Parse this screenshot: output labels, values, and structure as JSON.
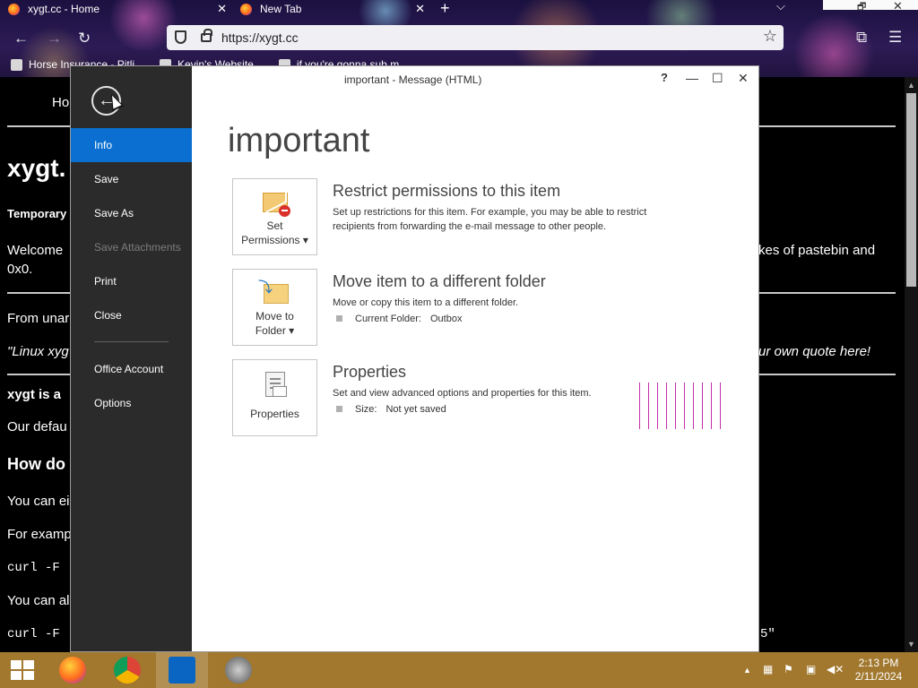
{
  "browser": {
    "tabs": [
      {
        "title": "xygt.cc - Home",
        "close": "✕"
      },
      {
        "title": "New Tab",
        "close": "✕"
      }
    ],
    "new_tab": "+",
    "window_controls": {
      "dropdown": "⌵",
      "restore": "🗗",
      "close": "✕"
    },
    "nav": {
      "back": "←",
      "forward": "→",
      "reload": "↻"
    },
    "url": "https://xygt.cc",
    "bookmark_star": "☆",
    "toolbar": {
      "extensions": "⧉",
      "menu": "☰"
    },
    "bookmarks": [
      {
        "label": "Horse Insurance - Pitli"
      },
      {
        "label": "Kevin's Website"
      },
      {
        "label": "if you're gonna sub m..."
      }
    ]
  },
  "webpage": {
    "nav_home": "Ho",
    "site_title": "xygt.",
    "subtitle": "Temporary",
    "welcome": "Welcome",
    "welcome_right": "kes of pastebin and",
    "line_0x0": "0x0.",
    "from_unar": "From unar",
    "quote_left": "\"Linux xyg",
    "quote_right": "ur own quote here!",
    "xygt_is_a": "xygt is a",
    "our_defau": "Our defau",
    "how_do": "How do",
    "you_can_ei": "You can ei",
    "for_examp": "For examp",
    "curl_1": "curl -F",
    "you_can_al": "You can al",
    "curl_2": "curl -F",
    "curl_2_end": "5\""
  },
  "outlook": {
    "window_title": "important - Message (HTML)",
    "title_controls": {
      "help": "?",
      "minimize": "—",
      "maximize": "☐",
      "close": "✕"
    },
    "back_label": "←",
    "sidebar": [
      {
        "label": "Info",
        "state": "active"
      },
      {
        "label": "Save",
        "state": "normal"
      },
      {
        "label": "Save As",
        "state": "normal"
      },
      {
        "label": "Save Attachments",
        "state": "disabled"
      },
      {
        "label": "Print",
        "state": "normal"
      },
      {
        "label": "Close",
        "state": "normal"
      },
      {
        "label": "Office Account",
        "state": "normal"
      },
      {
        "label": "Options",
        "state": "normal"
      }
    ],
    "heading": "important",
    "sections": [
      {
        "tile_label_1": "Set",
        "tile_label_2": "Permissions ▾",
        "icon": "envelope-restrict-icon",
        "title": "Restrict permissions to this item",
        "desc_1": "Set up restrictions for this item. For example, you may be able to restrict",
        "desc_2": "recipients from forwarding the e-mail message to other people."
      },
      {
        "tile_label_1": "Move to",
        "tile_label_2": "Folder ▾",
        "icon": "folder-move-icon",
        "title": "Move item to a different folder",
        "desc_1": "Move or copy this item to a different folder.",
        "kv_key": "Current Folder:",
        "kv_val": "Outbox"
      },
      {
        "tile_label_1": "Properties",
        "icon": "properties-icon",
        "title": "Properties",
        "desc_1": "Set and view advanced options and properties for this item.",
        "kv_key": "Size:",
        "kv_val": "Not yet saved"
      }
    ]
  },
  "taskbar": {
    "apps": [
      "firefox-icon",
      "chrome-icon",
      "outlook-icon",
      "safari-icon"
    ],
    "tray": {
      "chevron": "▲",
      "flag": "⚑"
    },
    "time": "2:13 PM",
    "date": "2/11/2024"
  },
  "colors": {
    "outlook_sidebar": "#2b2b2b",
    "outlook_active": "#0a6fd0",
    "taskbar": "#a1782e",
    "spinner": "#c22ea8"
  }
}
